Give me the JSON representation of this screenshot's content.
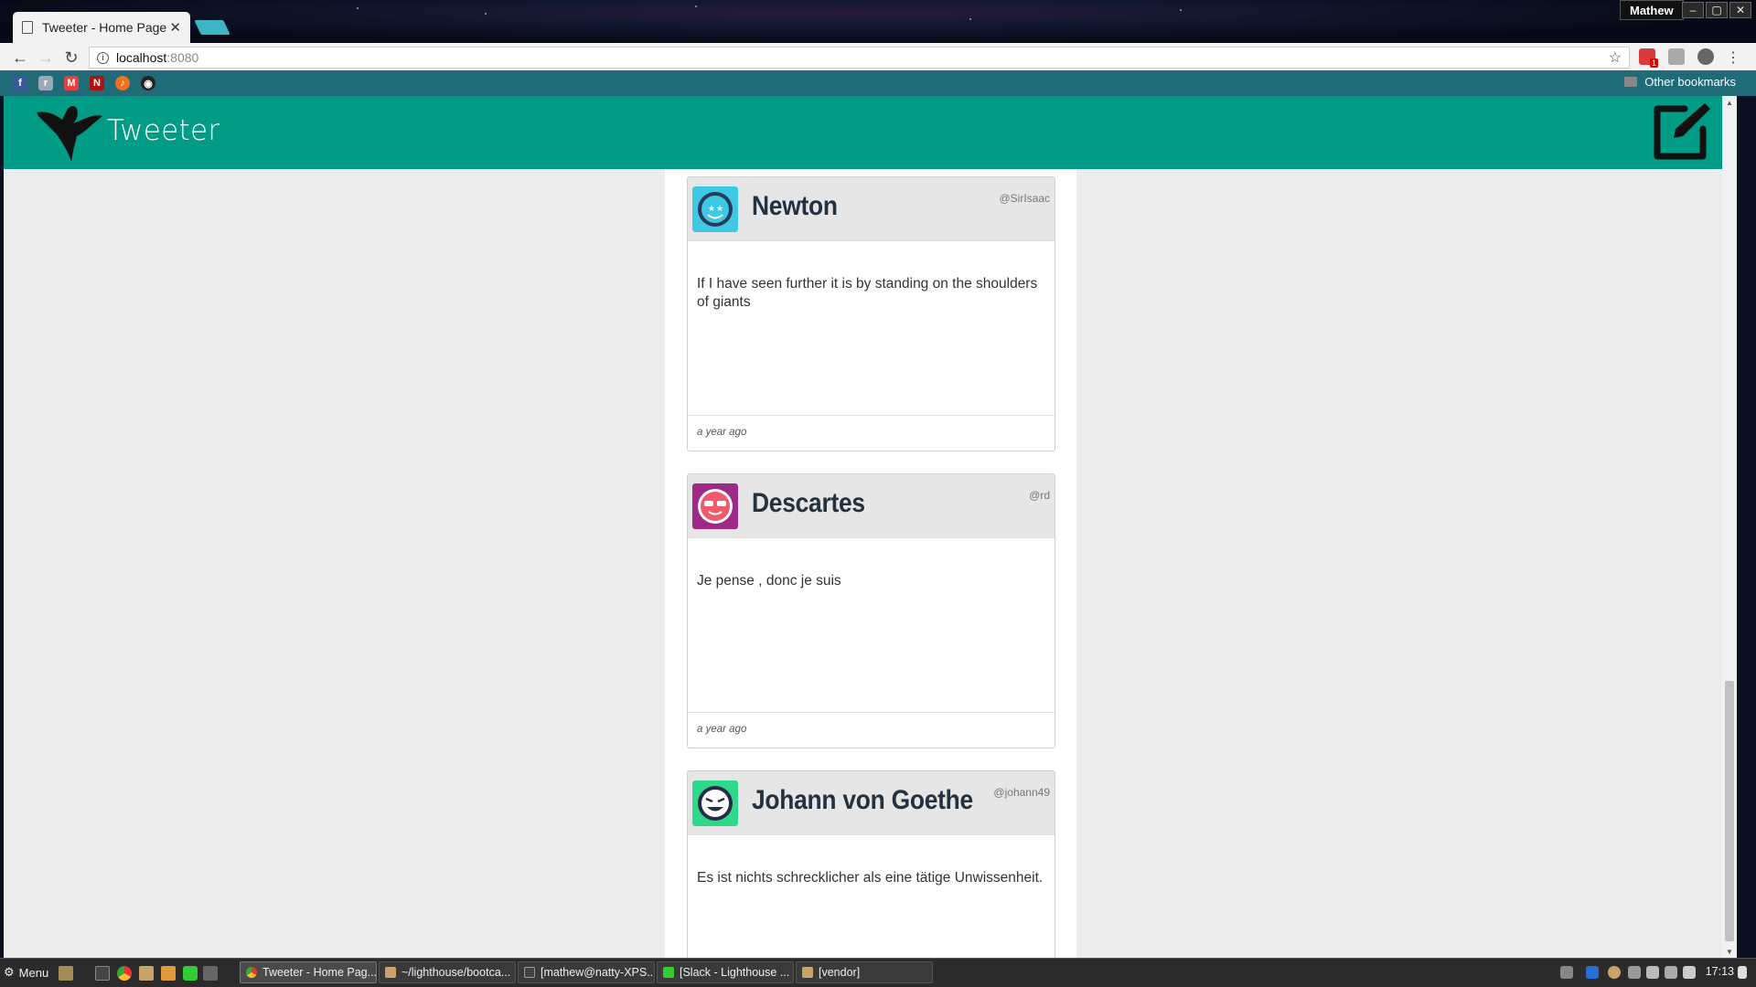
{
  "browser": {
    "tab_title": "Tweeter - Home Page",
    "tab_close": "✕",
    "user": "Mathew",
    "url_host": "localhost",
    "url_port": ":8080",
    "other_bookmarks": "Other bookmarks",
    "ext_badge": "1"
  },
  "app": {
    "title": "Tweeter",
    "header_color": "#009c85"
  },
  "tweets": [
    {
      "name": "Newton",
      "handle": "@SirIsaac",
      "text": "If I have seen further it is by standing on the shoulders of giants",
      "time": "a year ago",
      "avatar_color": "#3fc8e3"
    },
    {
      "name": "Descartes",
      "handle": "@rd",
      "text": "Je pense , donc je suis",
      "time": "a year ago",
      "avatar_color": "#9c2a86"
    },
    {
      "name": "Johann von Goethe",
      "handle": "@johann49",
      "text": "Es ist nichts schrecklicher als eine tätige Unwissenheit.",
      "time": "",
      "avatar_color": "#2ed98a"
    }
  ],
  "taskbar": {
    "menu_label": "Menu",
    "tasks": [
      "Tweeter - Home Pag...",
      "~/lighthouse/bootca...",
      "[mathew@natty-XPS...",
      "[Slack - Lighthouse ...",
      "[vendor]"
    ],
    "clock": "17:13"
  }
}
